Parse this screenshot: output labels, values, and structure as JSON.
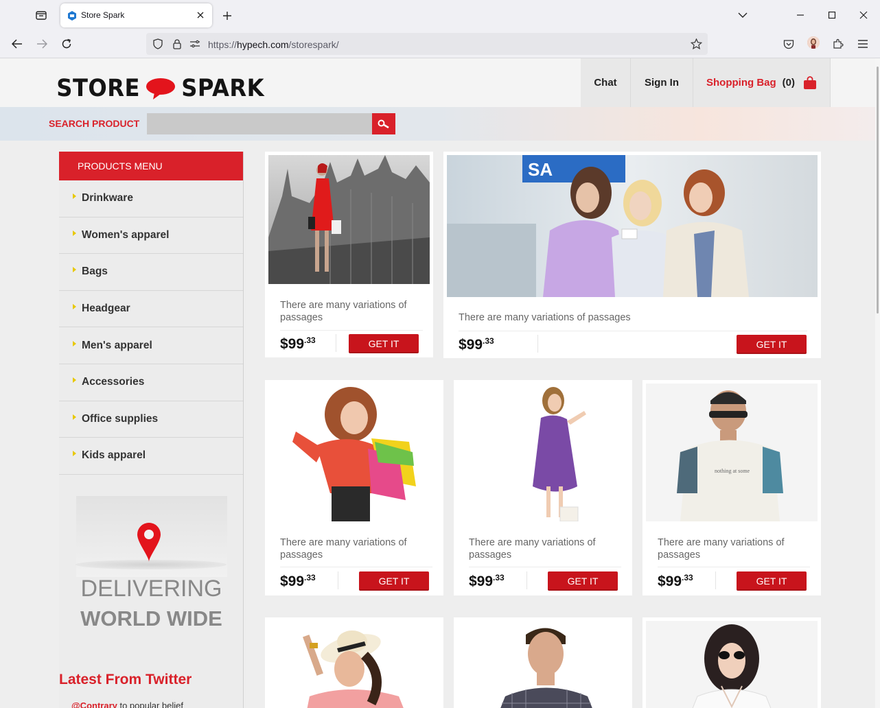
{
  "browser": {
    "tab_title": "Store Spark",
    "url_prefix": "https://",
    "url_host": "hypech.com",
    "url_path": "/storespark/"
  },
  "header": {
    "logo_left": "STORE",
    "logo_right": "SPARK",
    "nav": {
      "chat": "Chat",
      "signin": "Sign In",
      "bag_label": "Shopping Bag",
      "bag_count": "(0)"
    }
  },
  "search": {
    "label": "SEARCH PRODUCT",
    "placeholder": ""
  },
  "sidebar": {
    "menu_title": "PRODUCTS MENU",
    "items": [
      {
        "label": "Drinkware"
      },
      {
        "label": "Women's apparel"
      },
      {
        "label": "Bags"
      },
      {
        "label": "Headgear"
      },
      {
        "label": "Men's apparel"
      },
      {
        "label": "Accessories"
      },
      {
        "label": "Office supplies"
      },
      {
        "label": "Kids apparel"
      }
    ],
    "delivering_line1": "DELIVERING",
    "delivering_line2": "WORLD WIDE",
    "twitter_title": "Latest From Twitter",
    "tweet_handle": "@Contrary",
    "tweet_text": " to popular belief"
  },
  "products": [
    {
      "desc": "There are many variations of passages",
      "price_main": "$99",
      "price_cents": ".33",
      "button": "GET IT"
    },
    {
      "desc": "There are many variations of passages",
      "price_main": "$99",
      "price_cents": ".33",
      "button": "GET IT"
    },
    {
      "desc": "There are many variations of passages",
      "price_main": "$99",
      "price_cents": ".33",
      "button": "GET IT"
    },
    {
      "desc": "There are many variations of passages",
      "price_main": "$99",
      "price_cents": ".33",
      "button": "GET IT"
    },
    {
      "desc": "There are many variations of passages",
      "price_main": "$99",
      "price_cents": ".33",
      "button": "GET IT"
    }
  ],
  "colors": {
    "brand_red": "#d9212a",
    "button_red": "#c8141c",
    "page_bg": "#eeeeee"
  }
}
